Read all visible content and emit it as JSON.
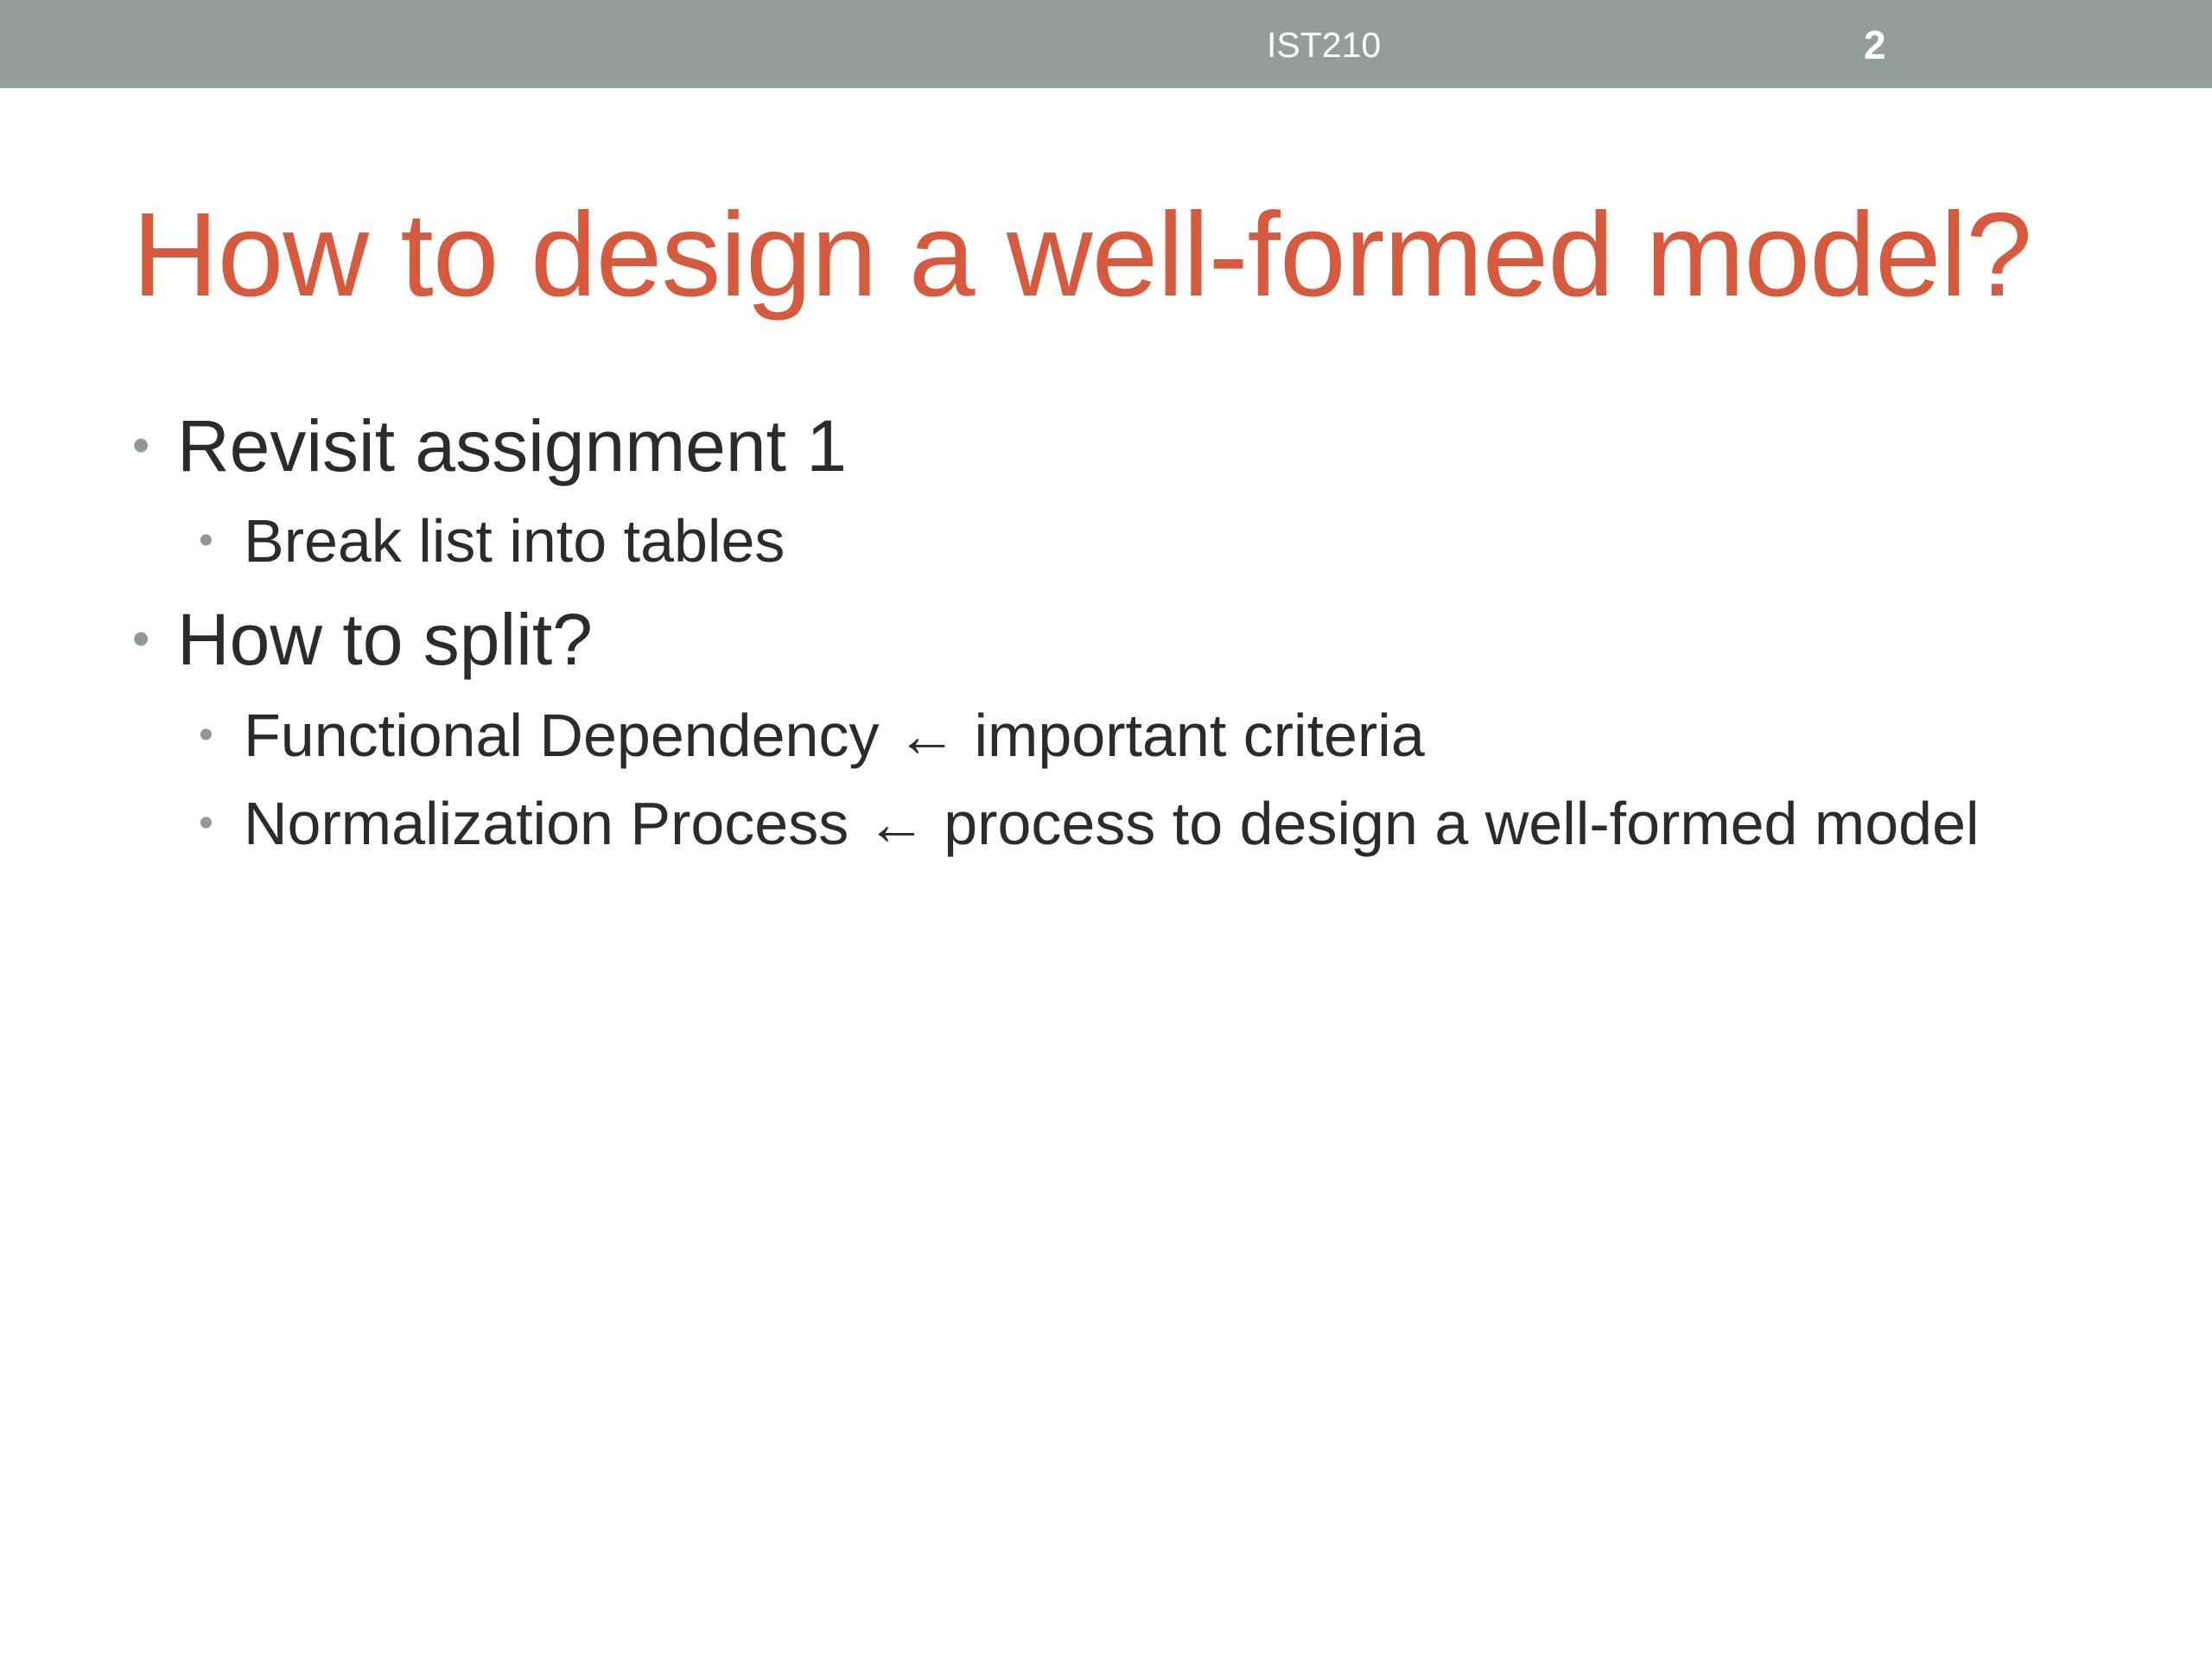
{
  "header": {
    "course_code": "IST210",
    "slide_number": "2",
    "bar_color": "#929f98"
  },
  "title": {
    "text": "How to design a well-formed model?",
    "color": "#d55a3e"
  },
  "bullets": [
    {
      "level": 1,
      "text": "Revisit assignment 1",
      "children": [
        {
          "level": 2,
          "text": "Break list into tables"
        }
      ]
    },
    {
      "level": 1,
      "text": "How to split?",
      "children": [
        {
          "level": 2,
          "term": "Functional Dependency",
          "arrow": "←",
          "note": "important criteria"
        },
        {
          "level": 2,
          "term": "Normalization Process",
          "arrow": "←",
          "note": "process to design a well-formed model"
        }
      ]
    }
  ],
  "bullet_marker": "•"
}
